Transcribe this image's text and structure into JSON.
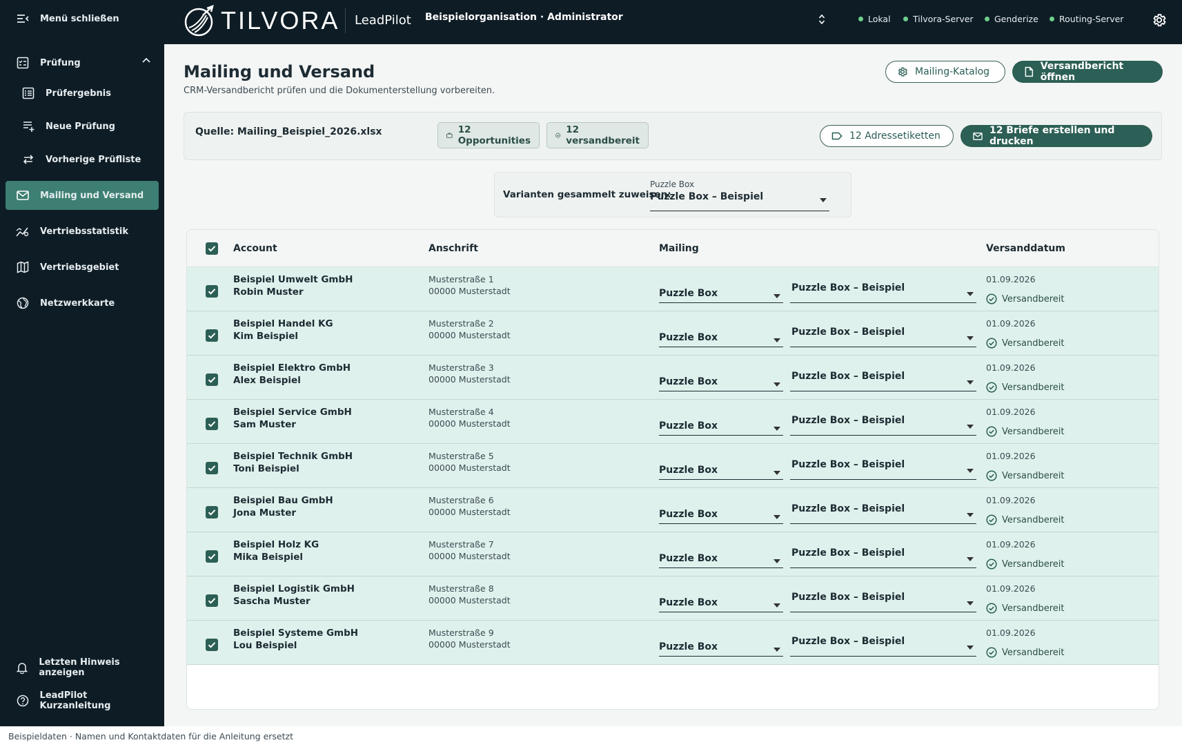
{
  "sidebar": {
    "close_label": "Menü schließen",
    "section_label": "Prüfung",
    "items": [
      {
        "label": "Prüfergebnis"
      },
      {
        "label": "Neue Prüfung"
      },
      {
        "label": "Vorherige Prüfliste"
      },
      {
        "label": "Mailing und Versand"
      },
      {
        "label": "Vertriebsstatistik"
      },
      {
        "label": "Vertriebsgebiet"
      },
      {
        "label": "Netzwerkkarte"
      }
    ],
    "bottom": [
      {
        "label": "Letzten Hinweis anzeigen"
      },
      {
        "label": "LeadPilot Kurzanleitung"
      }
    ],
    "active_color": "#3d7f72"
  },
  "topbar": {
    "logo_text": "TILVORA",
    "product": "LeadPilot",
    "org": "Beispielorganisation · Administrator",
    "status": [
      {
        "label": "Lokal"
      },
      {
        "label": "Tilvora-Server"
      },
      {
        "label": "Genderize"
      },
      {
        "label": "Routing-Server"
      }
    ]
  },
  "page": {
    "title": "Mailing und Versand",
    "subtitle": "CRM-Versandbericht prüfen und die Dokumenterstellung vorbereiten.",
    "catalog_button": "Mailing-Katalog",
    "report_button": "Versandbericht öffnen"
  },
  "source": {
    "label": "Quelle: Mailing_Beispiel_2026.xlsx",
    "opportunities": "12 Opportunities",
    "ready": "12 versandbereit",
    "labels_button": "12 Adressetiketten",
    "letters_button": "12 Briefe erstellen und drucken"
  },
  "variant": {
    "label": "Varianten gesammelt zuweisen:",
    "small": "Puzzle Box",
    "value": "Puzzle Box – Beispiel"
  },
  "table": {
    "headers": {
      "account": "Account",
      "address": "Anschrift",
      "mailing": "Mailing",
      "date": "Versanddatum"
    },
    "rows": [
      {
        "company": "Beispiel Umwelt GmbH",
        "person": "Robin Muster",
        "street": "Musterstraße 1",
        "city": "00000 Musterstadt",
        "mailing": "Puzzle Box",
        "variant": "Puzzle Box – Beispiel",
        "date": "01.09.2026",
        "status": "Versandbereit"
      },
      {
        "company": "Beispiel Handel KG",
        "person": "Kim Beispiel",
        "street": "Musterstraße 2",
        "city": "00000 Musterstadt",
        "mailing": "Puzzle Box",
        "variant": "Puzzle Box – Beispiel",
        "date": "01.09.2026",
        "status": "Versandbereit"
      },
      {
        "company": "Beispiel Elektro GmbH",
        "person": "Alex Beispiel",
        "street": "Musterstraße 3",
        "city": "00000 Musterstadt",
        "mailing": "Puzzle Box",
        "variant": "Puzzle Box – Beispiel",
        "date": "01.09.2026",
        "status": "Versandbereit"
      },
      {
        "company": "Beispiel Service GmbH",
        "person": "Sam Muster",
        "street": "Musterstraße 4",
        "city": "00000 Musterstadt",
        "mailing": "Puzzle Box",
        "variant": "Puzzle Box – Beispiel",
        "date": "01.09.2026",
        "status": "Versandbereit"
      },
      {
        "company": "Beispiel Technik GmbH",
        "person": "Toni Beispiel",
        "street": "Musterstraße 5",
        "city": "00000 Musterstadt",
        "mailing": "Puzzle Box",
        "variant": "Puzzle Box – Beispiel",
        "date": "01.09.2026",
        "status": "Versandbereit"
      },
      {
        "company": "Beispiel Bau GmbH",
        "person": "Jona Muster",
        "street": "Musterstraße 6",
        "city": "00000 Musterstadt",
        "mailing": "Puzzle Box",
        "variant": "Puzzle Box – Beispiel",
        "date": "01.09.2026",
        "status": "Versandbereit"
      },
      {
        "company": "Beispiel Holz KG",
        "person": "Mika Beispiel",
        "street": "Musterstraße 7",
        "city": "00000 Musterstadt",
        "mailing": "Puzzle Box",
        "variant": "Puzzle Box – Beispiel",
        "date": "01.09.2026",
        "status": "Versandbereit"
      },
      {
        "company": "Beispiel Logistik GmbH",
        "person": "Sascha Muster",
        "street": "Musterstraße 8",
        "city": "00000 Musterstadt",
        "mailing": "Puzzle Box",
        "variant": "Puzzle Box – Beispiel",
        "date": "01.09.2026",
        "status": "Versandbereit"
      },
      {
        "company": "Beispiel Systeme GmbH",
        "person": "Lou Beispiel",
        "street": "Musterstraße 9",
        "city": "00000 Musterstadt",
        "mailing": "Puzzle Box",
        "variant": "Puzzle Box – Beispiel",
        "date": "01.09.2026",
        "status": "Versandbereit"
      }
    ]
  },
  "footer": {
    "text": "Beispieldaten · Namen und Kontaktdaten für die Anleitung ersetzt"
  },
  "colors": {
    "accent": "#2c5f55",
    "row_bg": "#dff1ec",
    "sidebar_bg": "#0e1c25"
  }
}
